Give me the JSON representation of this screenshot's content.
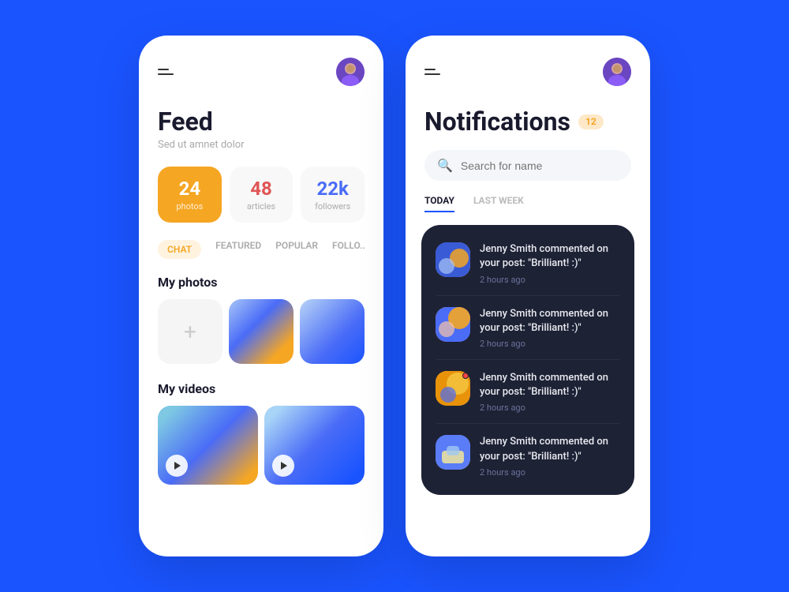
{
  "background_color": "#1a54ff",
  "feed_screen": {
    "hamburger_label": "menu",
    "title": "Feed",
    "subtitle": "Sed ut amnet dolor",
    "stats": [
      {
        "number": "24",
        "label": "photos",
        "type": "orange"
      },
      {
        "number": "48",
        "label": "articles",
        "type": "white"
      },
      {
        "number": "22k",
        "label": "followers",
        "type": "white"
      }
    ],
    "tabs": [
      {
        "label": "CHAT",
        "active": true
      },
      {
        "label": "FEATURED",
        "active": false
      },
      {
        "label": "POPULAR",
        "active": false
      },
      {
        "label": "FOLLO...",
        "active": false
      }
    ],
    "my_photos_label": "My photos",
    "my_videos_label": "My videos",
    "add_photo_label": "+"
  },
  "notifications_screen": {
    "title": "Notifications",
    "badge_count": "12",
    "search_placeholder": "Search for name",
    "date_tabs": [
      {
        "label": "TODAY",
        "active": true
      },
      {
        "label": "LAST WEEK",
        "active": false
      }
    ],
    "notifications": [
      {
        "user": "Jenny Smith",
        "text": "Jenny Smith commented on your post: \"Brilliant! :)\"",
        "time": "2 hours ago",
        "has_dot": false,
        "avatar_type": "1"
      },
      {
        "user": "Jenny Smith",
        "text": "Jenny Smith commented on your post: \"Brilliant! :)\"",
        "time": "2 hours ago",
        "has_dot": false,
        "avatar_type": "2"
      },
      {
        "user": "Jenny Smith",
        "text": "Jenny Smith commented on your post: \"Brilliant! :)\"",
        "time": "2 hours ago",
        "has_dot": true,
        "avatar_type": "3"
      },
      {
        "user": "Jenny Smith",
        "text": "Jenny Smith commented on your post: \"Brilliant! :)\"",
        "time": "2 hours ago",
        "has_dot": false,
        "avatar_type": "4"
      }
    ]
  }
}
